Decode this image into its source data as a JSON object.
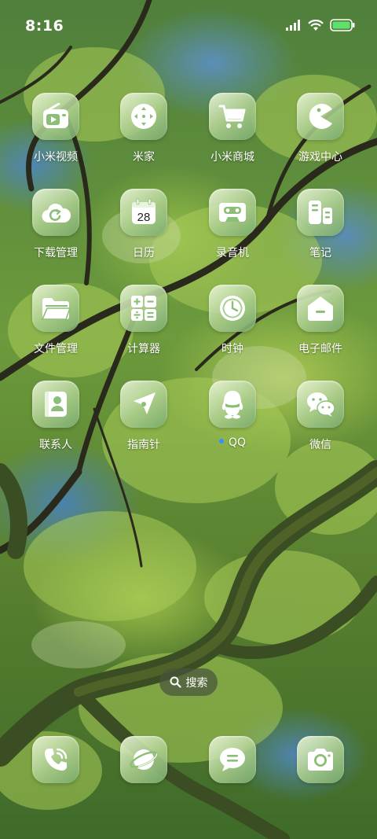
{
  "status_bar": {
    "time": "8:16",
    "icons": [
      "signal-icon",
      "wifi-icon",
      "battery-icon"
    ]
  },
  "apps": [
    {
      "label": "小米视频",
      "icon": "video-player-icon"
    },
    {
      "label": "米家",
      "icon": "mijia-dpad-icon"
    },
    {
      "label": "小米商城",
      "icon": "shopping-cart-icon"
    },
    {
      "label": "游戏中心",
      "icon": "pacman-icon"
    },
    {
      "label": "下载管理",
      "icon": "cloud-download-icon"
    },
    {
      "label": "日历",
      "icon": "calendar-icon",
      "date": "28"
    },
    {
      "label": "录音机",
      "icon": "cassette-icon"
    },
    {
      "label": "笔记",
      "icon": "notes-icon"
    },
    {
      "label": "文件管理",
      "icon": "folder-icon"
    },
    {
      "label": "计算器",
      "icon": "calculator-icon"
    },
    {
      "label": "时钟",
      "icon": "clock-icon"
    },
    {
      "label": "电子邮件",
      "icon": "mail-icon"
    },
    {
      "label": "联系人",
      "icon": "contacts-icon"
    },
    {
      "label": "指南针",
      "icon": "compass-icon"
    },
    {
      "label": "QQ",
      "icon": "qq-penguin-icon",
      "new_install_dot": true
    },
    {
      "label": "微信",
      "icon": "wechat-icon"
    }
  ],
  "search": {
    "label": "搜索",
    "icon": "search-icon"
  },
  "dock": [
    {
      "name": "phone",
      "icon": "phone-icon"
    },
    {
      "name": "browser",
      "icon": "planet-browser-icon"
    },
    {
      "name": "messages",
      "icon": "message-icon"
    },
    {
      "name": "camera",
      "icon": "camera-icon"
    }
  ],
  "colors": {
    "icon_tile": "#c6dfae",
    "icon_glyph": "#ffffff",
    "accent_dot": "#3d8cff"
  }
}
